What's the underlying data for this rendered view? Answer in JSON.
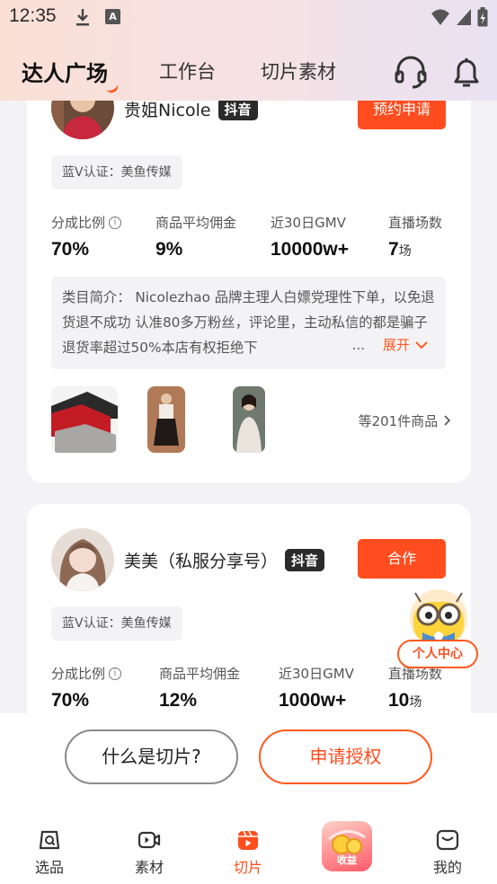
{
  "status_bar": {
    "time": "12:35",
    "a_icon_label": "A"
  },
  "nav": {
    "tabs": [
      {
        "label": "达人广场"
      },
      {
        "label": "工作台"
      },
      {
        "label": "切片素材"
      }
    ],
    "accent": "#ff5a1f"
  },
  "cards": [
    {
      "name": "贵姐Nicole",
      "platform": "抖音",
      "action": "预约申请",
      "cert": "蓝V认证：美鱼传媒",
      "stats": [
        {
          "label": "分成比例",
          "value": "70%"
        },
        {
          "label": "商品平均佣金",
          "value": "9%"
        },
        {
          "label": "近30日GMV",
          "value": "10000w+"
        },
        {
          "label": "直播场数",
          "value": "7",
          "unit": "场"
        }
      ],
      "intro": "类目简介： Nicolezhao 品牌主理人白嫖党理性下单，以免退货退不成功 认准80多万粉丝，评论里，主动私信的都是骗子退货率超过50%本店有权拒绝下",
      "intro_ellipsis": "...",
      "expand": "展开",
      "more_goods": "等201件商品"
    },
    {
      "name": "美美（私服分享号）",
      "platform": "抖音",
      "action": "合作",
      "cert": "蓝V认证：美鱼传媒",
      "stats": [
        {
          "label": "分成比例",
          "value": "70%"
        },
        {
          "label": "商品平均佣金",
          "value": "12%"
        },
        {
          "label": "近30日GMV",
          "value": "1000w+"
        },
        {
          "label": "直播场数",
          "value": "10",
          "unit": "场"
        }
      ]
    }
  ],
  "float_center": {
    "label": "个人中心"
  },
  "bottom": {
    "what_is_clip": "什么是切片?",
    "apply_auth": "申请授权"
  },
  "tabbar": {
    "items": [
      {
        "label": "选品"
      },
      {
        "label": "素材"
      },
      {
        "label": "切片"
      },
      {
        "label": "收益"
      },
      {
        "label": "我的"
      }
    ]
  }
}
